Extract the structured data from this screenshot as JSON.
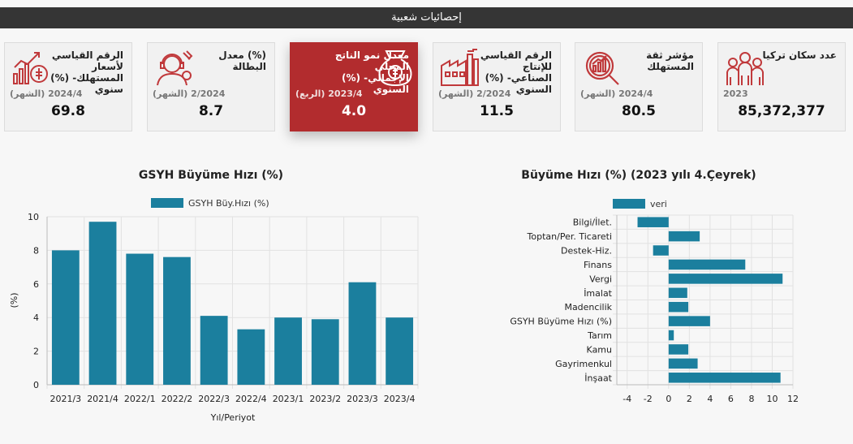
{
  "header": {
    "title": "إحصائيات شعبية"
  },
  "cards": [
    {
      "title": "الرقم القياسي لأسعار المستهلك- (%) سنوي",
      "period": "(الشهر) 2024/4",
      "value": "69.8",
      "icon": "price-chart-icon",
      "active": false
    },
    {
      "title": "(%) معدل البطالة",
      "period": "(الشهر) 2/2024",
      "value": "8.7",
      "icon": "worker-headset-icon",
      "active": false
    },
    {
      "title": "معدل نمو الناتج المحلي الإجمالي- (%) السنوي",
      "period": "(الربع) 2023/4",
      "value": "4.0",
      "icon": "money-bag-icon",
      "active": true
    },
    {
      "title": "الرقم القياسي للإنتاج الصناعي- (%) السنوي",
      "period": "(الشهر) 2/2024",
      "value": "11.5",
      "icon": "factory-icon",
      "active": false
    },
    {
      "title": "مؤشر ثقة المستهلك",
      "period": "(الشهر) 2024/4",
      "value": "80.5",
      "icon": "magnifier-chart-icon",
      "active": false
    },
    {
      "title": "عدد سكان تركيا",
      "period": "2023",
      "value": "85,372,377",
      "icon": "people-icon",
      "active": false
    }
  ],
  "colors": {
    "accent": "#b22c2e",
    "bar": "#1b7f9e",
    "header": "#353535"
  },
  "chart_data": [
    {
      "type": "bar",
      "title": "GSYH Büyüme Hızı (%)",
      "xlabel": "Yıl/Periyot",
      "ylabel": "(%)",
      "categories": [
        "2021/3",
        "2021/4",
        "2022/1",
        "2022/2",
        "2022/3",
        "2022/4",
        "2023/1",
        "2023/2",
        "2023/3",
        "2023/4"
      ],
      "series": [
        {
          "name": "GSYH Büy.Hızı (%)",
          "values": [
            8.0,
            9.7,
            7.8,
            7.6,
            4.1,
            3.3,
            4.0,
            3.9,
            6.1,
            4.0
          ]
        }
      ],
      "ylim": [
        0,
        10
      ],
      "yticks": [
        0,
        2,
        4,
        6,
        8,
        10
      ],
      "legend": "top",
      "grid": true
    },
    {
      "type": "bar",
      "orientation": "horizontal",
      "title": "Büyüme Hızı (%) (2023 yılı 4.Çeyrek)",
      "categories": [
        "Bilgi/İlet.",
        "Toptan/Per. Ticareti",
        "Destek-Hiz.",
        "Finans",
        "Vergi",
        "İmalat",
        "Madencilik",
        "GSYH Büyüme Hızı (%)",
        "Tarım",
        "Kamu",
        "Gayrimenkul",
        "İnşaat"
      ],
      "series": [
        {
          "name": "veri",
          "values": [
            -3.0,
            3.0,
            -1.5,
            7.4,
            11.0,
            1.8,
            1.9,
            4.0,
            0.5,
            1.9,
            2.8,
            10.8
          ]
        }
      ],
      "xlim": [
        -5,
        12
      ],
      "xticks": [
        -4,
        -2,
        0,
        2,
        4,
        6,
        8,
        10,
        12
      ],
      "xtick_labels": [
        "-4",
        "-2",
        "0",
        "2",
        "4",
        "6",
        "8",
        "10",
        "12"
      ],
      "legend": "top",
      "grid": true
    }
  ]
}
